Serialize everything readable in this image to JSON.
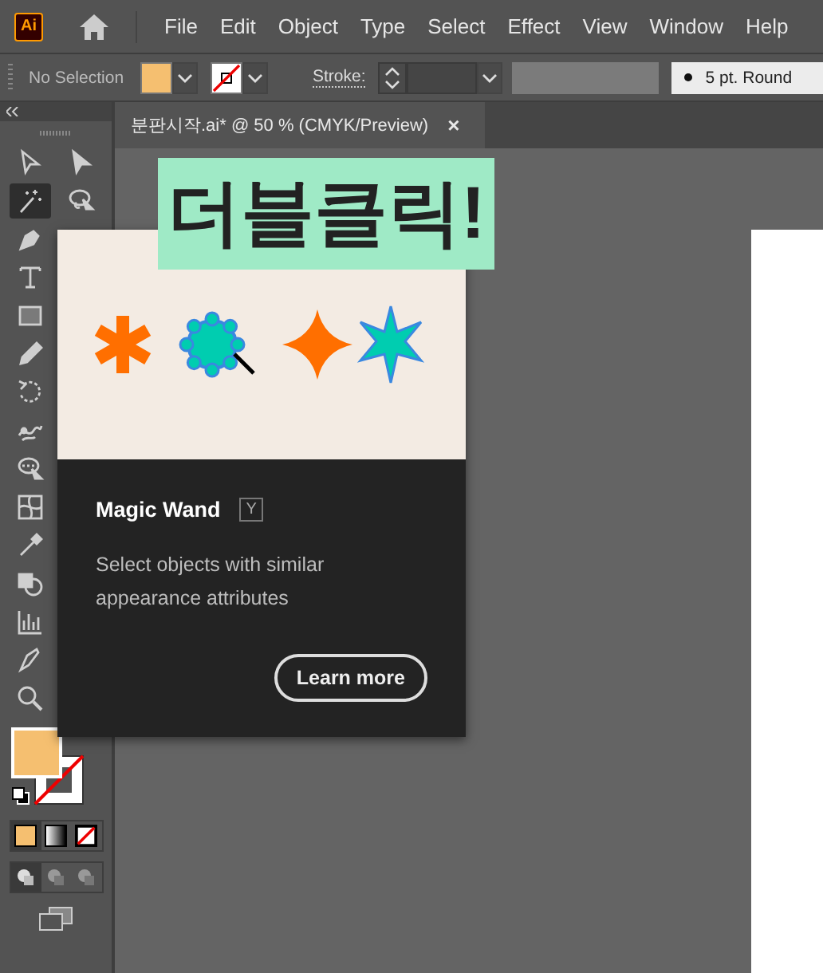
{
  "menu_bar": {
    "logo": "Ai",
    "items": [
      "File",
      "Edit",
      "Object",
      "Type",
      "Select",
      "Effect",
      "View",
      "Window",
      "Help"
    ]
  },
  "control_bar": {
    "selection_label": "No Selection",
    "stroke_label": "Stroke:",
    "brush": "5 pt. Round"
  },
  "document_tab": {
    "title": "분판시작.ai* @ 50 % (CMYK/Preview)",
    "close": "×"
  },
  "tools": [
    {
      "kind": "select",
      "selected": false
    },
    {
      "kind": "direct-select",
      "selected": false
    },
    {
      "kind": "magic-wand",
      "selected": true
    },
    {
      "kind": "lasso",
      "selected": false
    },
    {
      "kind": "pen",
      "selected": false
    },
    {
      "kind": "type",
      "selected": false
    },
    {
      "kind": "rectangle",
      "selected": false
    },
    {
      "kind": "pencil",
      "selected": false
    },
    {
      "kind": "rotate",
      "selected": false
    },
    {
      "kind": "warp",
      "selected": false
    },
    {
      "kind": "shape-select",
      "selected": false
    },
    {
      "kind": "mesh",
      "selected": false
    },
    {
      "kind": "eyedropper",
      "selected": false
    },
    {
      "kind": "shape-builder",
      "selected": false
    },
    {
      "kind": "graph",
      "selected": false
    },
    {
      "kind": "knife",
      "selected": false
    },
    {
      "kind": "zoom",
      "selected": false
    }
  ],
  "color_modes": [
    {
      "kind": "color",
      "selected": true
    },
    {
      "kind": "gradient",
      "selected": false
    },
    {
      "kind": "none",
      "selected": false
    }
  ],
  "draw_modes": [
    {
      "selected": true
    },
    {
      "selected": false
    },
    {
      "selected": false
    }
  ],
  "tooltip": {
    "title": "Magic Wand",
    "shortcut": "Y",
    "description": "Select objects with similar appearance attributes",
    "button": "Learn more"
  },
  "banner": {
    "text": "더블클릭!"
  }
}
